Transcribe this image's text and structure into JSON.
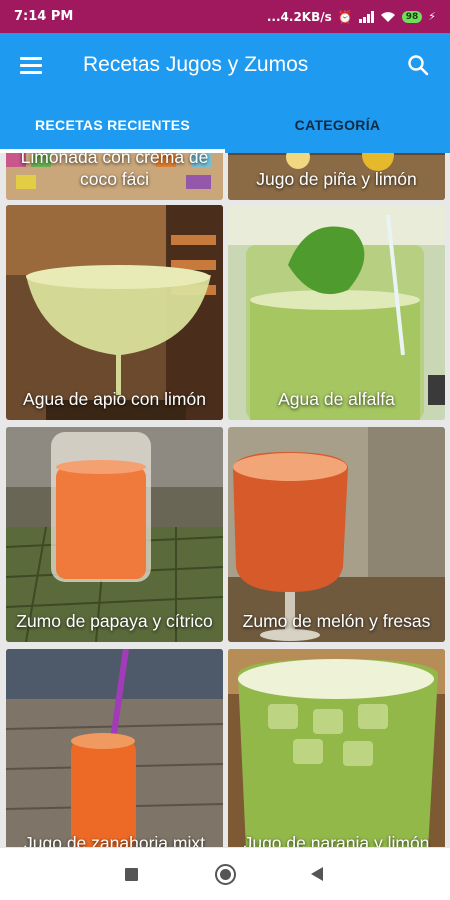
{
  "status_bar": {
    "time": "7:14 PM",
    "net_speed": "...4.2KB/s",
    "battery": "98"
  },
  "app_bar": {
    "title": "Recetas Jugos y Zumos",
    "menu_icon": "menu-icon",
    "search_icon": "search-icon"
  },
  "tabs": [
    {
      "label": "RECETAS RECIENTES",
      "active": true
    },
    {
      "label": "CATEGORÍA",
      "active": false
    }
  ],
  "recipes": [
    {
      "title": "Limonada con crema de coco fáci"
    },
    {
      "title": "Jugo de piña y limón"
    },
    {
      "title": "Agua de apio con limón"
    },
    {
      "title": "Agua de alfalfa"
    },
    {
      "title": "Zumo de papaya y cítrico"
    },
    {
      "title": "Zumo de melón y fresas"
    },
    {
      "title": "Jugo de zanahoria mixt"
    },
    {
      "title": "Jugo de naranja y limón"
    }
  ],
  "colors": {
    "status_bar": "#a0185e",
    "app_bar": "#1e9bf0",
    "tab_active_text": "#ffffff",
    "tab_inactive_text": "#102a43"
  }
}
